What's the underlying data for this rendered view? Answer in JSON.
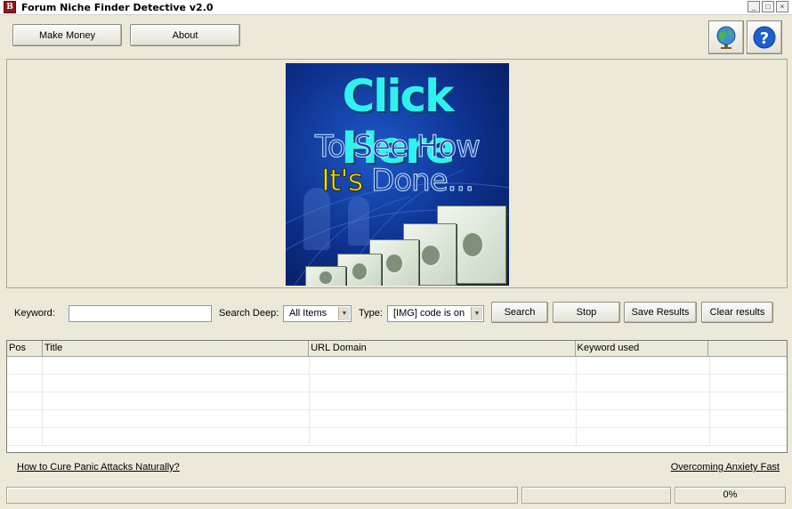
{
  "window": {
    "title": "Forum Niche Finder Detective v2.0",
    "app_icon_letter": "B",
    "controls": [
      "_",
      "□",
      "×"
    ]
  },
  "toolbar": {
    "make_money_label": "Make Money",
    "about_label": "About",
    "icons": [
      "globe-icon",
      "help-icon"
    ]
  },
  "banner": {
    "line1": "Click Here",
    "line2": "To See How",
    "line3_highlight": "It's",
    "line3_rest": " Done..."
  },
  "search": {
    "keyword_label": "Keyword:",
    "keyword_value": "",
    "deep_label": "Search Deep:",
    "deep_value": "All Items",
    "type_label": "Type:",
    "type_value": "[IMG] code is on",
    "search_label": "Search",
    "stop_label": "Stop",
    "save_label": "Save Results",
    "clear_label": "Clear results"
  },
  "grid": {
    "columns": [
      "Pos",
      "Title",
      "URL Domain",
      "Keyword used",
      ""
    ],
    "rows": 5
  },
  "links": {
    "left": "How to Cure Panic Attacks Naturally?",
    "right": "Overcoming Anxiety Fast"
  },
  "status": {
    "progress_text": "0%"
  }
}
